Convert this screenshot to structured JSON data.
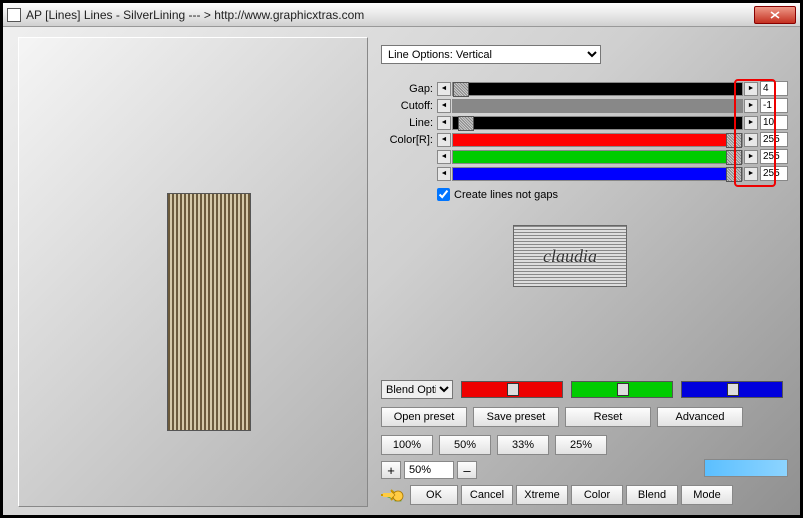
{
  "window": {
    "title": "AP [Lines]  Lines - SilverLining   --- >  http://www.graphicxtras.com"
  },
  "dropdown": {
    "selected": "Line Options: Vertical"
  },
  "sliders": {
    "gap": {
      "label": "Gap:",
      "value": "4"
    },
    "cutoff": {
      "label": "Cutoff:",
      "value": "-1"
    },
    "line": {
      "label": "Line:",
      "value": "10"
    },
    "colorR": {
      "label": "Color[R]:",
      "value": "255"
    },
    "colorG": {
      "label": "",
      "value": "255"
    },
    "colorB": {
      "label": "",
      "value": "255"
    }
  },
  "checkbox": {
    "label": "Create lines not gaps",
    "checked": true
  },
  "logo": {
    "text": "claudia"
  },
  "blend": {
    "selected": "Blend Options"
  },
  "buttons": {
    "open_preset": "Open preset",
    "save_preset": "Save preset",
    "reset": "Reset",
    "advanced": "Advanced",
    "p100": "100%",
    "p50": "50%",
    "p33": "33%",
    "p25": "25%",
    "ok": "OK",
    "cancel": "Cancel",
    "xtreme": "Xtreme",
    "color": "Color",
    "blend": "Blend",
    "mode": "Mode"
  },
  "zoom": {
    "plus": "+",
    "minus": "–",
    "value": "50%"
  }
}
